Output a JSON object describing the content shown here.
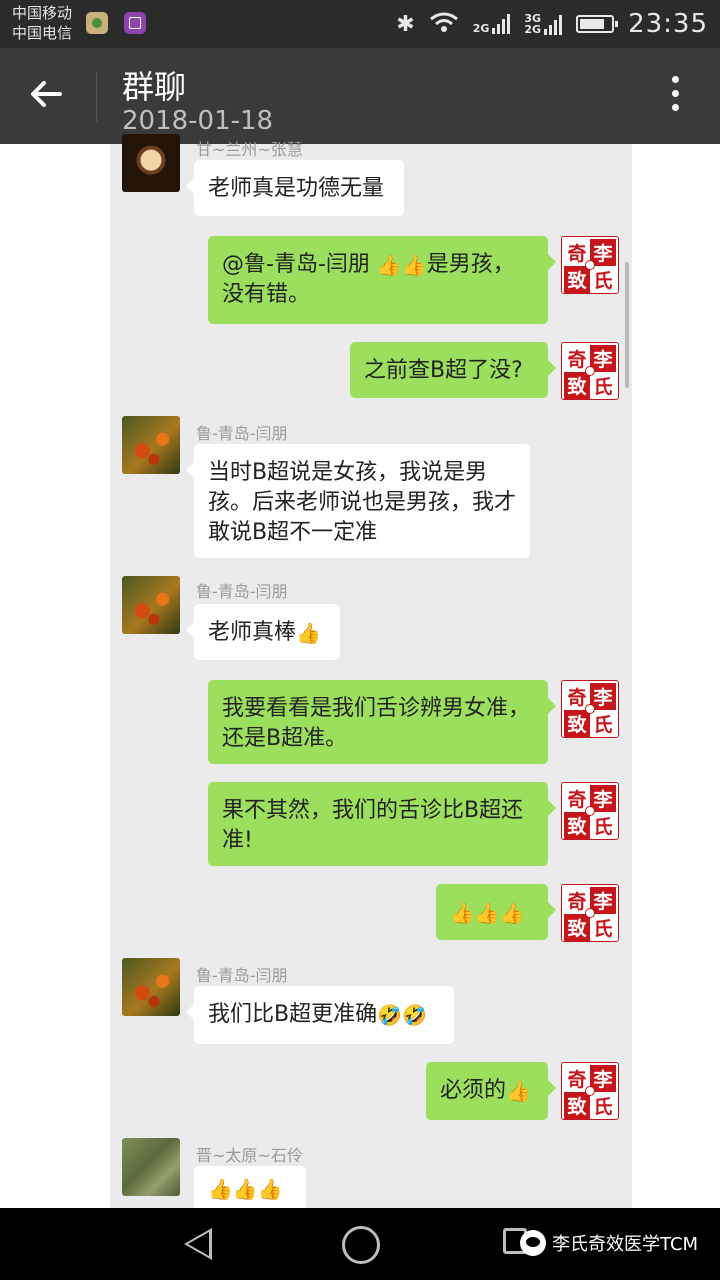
{
  "status_bar": {
    "carrier_1": "中国移动",
    "carrier_2": "中国电信",
    "bluetooth_icon": "bluetooth-icon",
    "wifi_icon": "wifi-icon",
    "network_1": "2G",
    "network_2": "3G",
    "network_3": "2G",
    "battery_icon": "battery-charging-icon",
    "time": "23:35"
  },
  "header": {
    "back_icon": "back-arrow-icon",
    "title": "群聊",
    "subtitle": "2018-01-18",
    "more_icon": "more-vertical-icon"
  },
  "seal": {
    "chars": [
      "奇",
      "李",
      "致",
      "氏"
    ]
  },
  "messages": [
    {
      "side": "in",
      "sender": "甘~兰州~张慧",
      "text": "老师真是功德无量"
    },
    {
      "side": "out",
      "text": "@鲁-青岛-闫朋 ",
      "emoji": "👍👍",
      "text_after": "是男孩，没有错。"
    },
    {
      "side": "out",
      "text": "之前查B超了没?"
    },
    {
      "side": "in",
      "sender": "鲁-青岛-闫朋",
      "text": "当时B超说是女孩，我说是男孩。后来老师说也是男孩，我才敢说B超不一定准"
    },
    {
      "side": "in",
      "sender": "鲁-青岛-闫朋",
      "text": "老师真棒",
      "emoji": "👍"
    },
    {
      "side": "out",
      "text": "我要看看是我们舌诊辨男女准，还是B超准。"
    },
    {
      "side": "out",
      "text": "果不其然，我们的舌诊比B超还准!"
    },
    {
      "side": "out",
      "emoji": "👍👍👍"
    },
    {
      "side": "in",
      "sender": "鲁-青岛-闫朋",
      "text": "我们比B超更准确",
      "emoji": "🤣🤣"
    },
    {
      "side": "out",
      "text": "必须的",
      "emoji": "👍"
    },
    {
      "side": "in",
      "sender": "晋~太原~石伶",
      "emoji": "👍👍👍"
    }
  ],
  "nav_bar": {
    "back_icon": "nav-back-icon",
    "home_icon": "nav-home-icon",
    "recents_icon": "nav-recents-icon",
    "watermark_text": "李氏奇效医学TCM"
  }
}
